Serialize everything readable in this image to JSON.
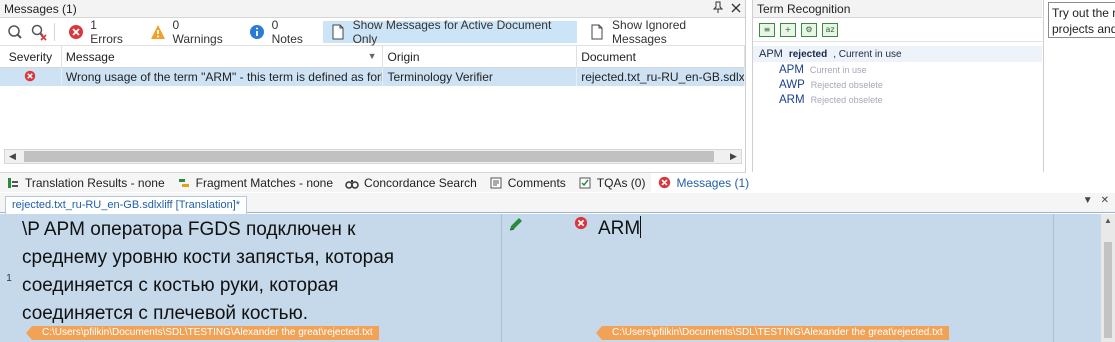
{
  "messages_panel": {
    "title": "Messages (1)",
    "pin_glyph": "⫫",
    "close_glyph": "✕",
    "toolbar": {
      "errors_label": "1 Errors",
      "warnings_label": "0 Warnings",
      "notes_label": "0 Notes",
      "active_doc_label": "Show Messages for Active Document Only",
      "ignored_label": "Show Ignored Messages"
    },
    "columns": [
      "Severity",
      "Message",
      "Origin",
      "Document"
    ],
    "rows": [
      {
        "severity_icon": "error-icon",
        "message": "Wrong usage of the term \"ARM\" - this term is defined as forbi...",
        "origin": "Terminology Verifier",
        "document": "rejected.txt_ru-RU_en-GB.sdlxlif"
      }
    ]
  },
  "term_panel": {
    "title": "Term Recognition",
    "source_term": "APM",
    "status_bold": "rejected",
    "status_rest": ", Current in use",
    "terms": [
      {
        "term": "APM",
        "status": "Current in use"
      },
      {
        "term": "AWP",
        "status": "Rejected obselete"
      },
      {
        "term": "ARM",
        "status": "Rejected obselete"
      }
    ]
  },
  "tip_panel": {
    "line1": "Try out the r",
    "line2": "projects and"
  },
  "bottom_tabs": [
    {
      "label": "Translation Results - none",
      "icon": "translation-results-icon"
    },
    {
      "label": "Fragment Matches - none",
      "icon": "fragment-matches-icon"
    },
    {
      "label": "Concordance Search",
      "icon": "concordance-icon"
    },
    {
      "label": "Comments",
      "icon": "comments-icon"
    },
    {
      "label": "TQAs (0)",
      "icon": "tqa-icon"
    },
    {
      "label": "Messages (1)",
      "icon": "error-icon",
      "active": true
    }
  ],
  "document_tab": {
    "label": "rejected.txt_ru-RU_en-GB.sdlxliff [Translation]*"
  },
  "editor": {
    "row_number": "1",
    "source_lines": [
      "\\P APM оператора FGDS подключен к",
      "среднему уровню кости запястья, которая",
      "соединяется с костью руки, которая",
      "соединяется с плечевой костью."
    ],
    "target_text": "ARM",
    "source_path": "C:\\Users\\pfilkin\\Documents\\SDL\\TESTING\\Alexander the great\\rejected.txt",
    "target_path": "C:\\Users\\pfilkin\\Documents\\SDL\\TESTING\\Alexander the great\\rejected.txt"
  },
  "colors": {
    "accent_blue": "#1f5fa8",
    "selected_row": "#cde3f4",
    "editor_bg": "#c5d9ea",
    "path_tag": "#f2a256",
    "error_red": "#d9363e",
    "warning_orange": "#f0a028",
    "info_blue": "#2a7bd6"
  }
}
